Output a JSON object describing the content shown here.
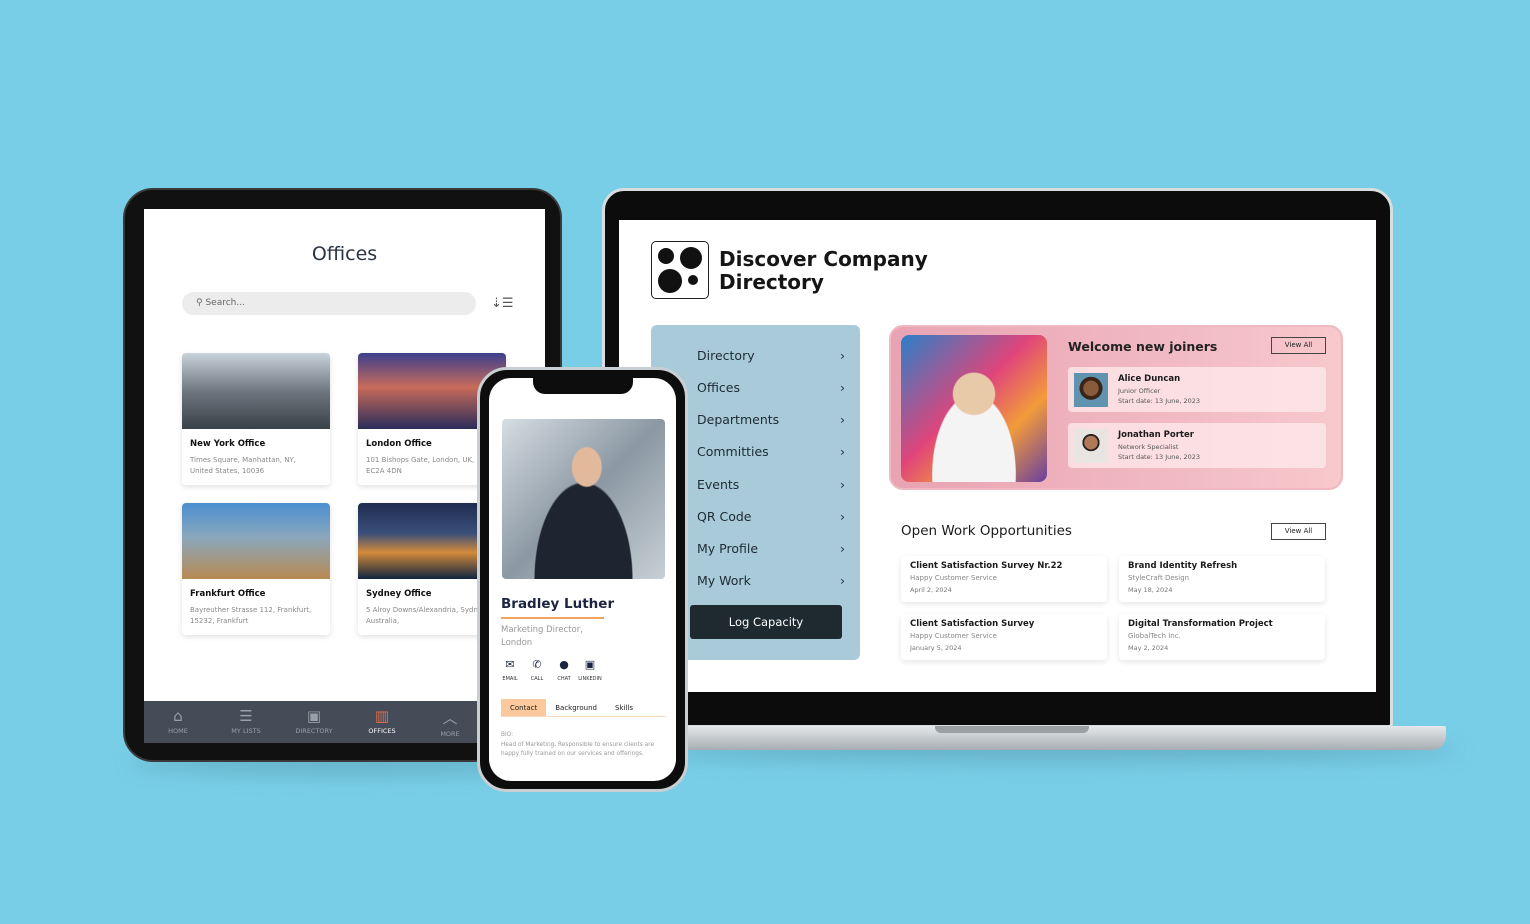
{
  "tablet": {
    "title": "Offices",
    "search_placeholder": "Search...",
    "offices": [
      {
        "name": "New York Office",
        "address": "Times Square, Manhattan, NY,",
        "address2": "United States, 10036"
      },
      {
        "name": "London Office",
        "address": "101 Bishops Gate, London, UK,",
        "address2": "EC2A 4DN"
      },
      {
        "name": "Frankfurt Office",
        "address": "Bayreuther Strasse 112, Frankfurt,",
        "address2": "15232, Frankfurt"
      },
      {
        "name": "Sydney Office",
        "address": "5 Alroy Downs/Alexandria, Sydney",
        "address2": "Australia,"
      }
    ],
    "nav": [
      {
        "label": "HOME",
        "icon": "home-icon"
      },
      {
        "label": "MY LISTS",
        "icon": "list-icon"
      },
      {
        "label": "DIRECTORY",
        "icon": "contacts-icon"
      },
      {
        "label": "OFFICES",
        "icon": "building-icon",
        "active": true
      },
      {
        "label": "MORE",
        "icon": "chevron-up-icon"
      }
    ]
  },
  "phone": {
    "name": "Bradley Luther",
    "role": "Marketing Director,",
    "location": "London",
    "actions": [
      {
        "label": "EMAIL",
        "icon": "email-icon"
      },
      {
        "label": "CALL",
        "icon": "phone-icon"
      },
      {
        "label": "CHAT",
        "icon": "chat-icon"
      },
      {
        "label": "LINKEDIN",
        "icon": "linkedin-icon"
      }
    ],
    "tabs": [
      "Contact",
      "Background",
      "Skills"
    ],
    "bio_label": "BIO:",
    "bio": "Head of Marketing, Responsible to ensure clients are happy fully trained on our services and offerings."
  },
  "laptop": {
    "title_line1": "Discover Company",
    "title_line2": "Directory",
    "menu": [
      "Directory",
      "Offices",
      "Departments",
      "Committies",
      "Events",
      "QR Code",
      "My Profile",
      "My Work"
    ],
    "log_capacity": "Log Capacity",
    "welcome": {
      "title": "Welcome new joiners",
      "view_all": "View All",
      "joiners": [
        {
          "name": "Alice Duncan",
          "role": "Junior Officer",
          "start": "Start date: 13 June, 2023"
        },
        {
          "name": "Jonathan Porter",
          "role": "Network Specialist",
          "start": "Start date: 13 June, 2023"
        }
      ]
    },
    "work": {
      "title": "Open Work Opportunities",
      "view_all": "View All",
      "items": [
        {
          "title": "Client Satisfaction Survey Nr.22",
          "company": "Happy Customer Service",
          "date": "April 2, 2024"
        },
        {
          "title": "Brand Identity Refresh",
          "company": "StyleCraft Design",
          "date": "May 18, 2024"
        },
        {
          "title": "Client Satisfaction Survey",
          "company": "Happy Customer Service",
          "date": "January 5, 2024"
        },
        {
          "title": "Digital Transformation Project",
          "company": "GlobalTech Inc.",
          "date": "May 2, 2024"
        }
      ]
    }
  },
  "colors": {
    "background": "#79cee7",
    "accent": "#f0a35a",
    "menu": "#a9cbd9",
    "button": "#1f2a30",
    "nav": "#454b57",
    "active_nav_icon": "#e0704f"
  }
}
